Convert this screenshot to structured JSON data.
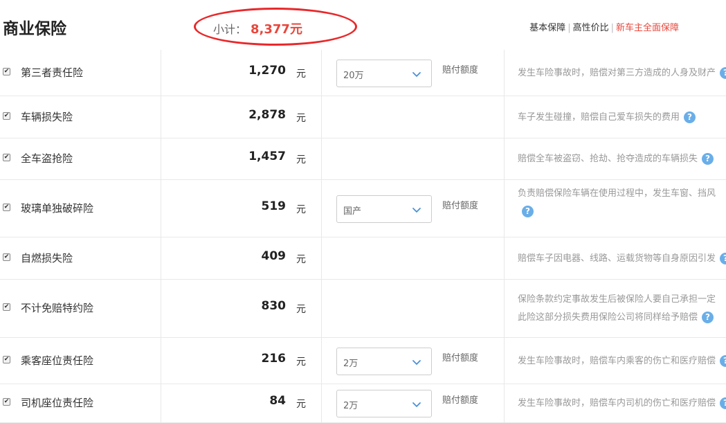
{
  "header": {
    "title": "商业保险",
    "subtotal_label": "小计：",
    "subtotal_value": "8,377元",
    "plans": [
      "基本保障",
      "高性价比",
      "新车主全面保障"
    ],
    "separator": "|"
  },
  "amount_label": "赔付额度",
  "help_glyph": "?",
  "rows": [
    {
      "name": "第三者责任险",
      "price": "1,270",
      "unit": "元",
      "select": "20万",
      "desc": [
        "发生车险事故时，赔偿对第三方造成的人身及财产"
      ]
    },
    {
      "name": "车辆损失险",
      "price": "2,878",
      "unit": "元",
      "select": null,
      "desc": [
        "车子发生碰撞，赔偿自己爱车损失的费用"
      ]
    },
    {
      "name": "全车盗抢险",
      "price": "1,457",
      "unit": "元",
      "select": null,
      "desc": [
        "赔偿全车被盗窃、抢劫、抢夺造成的车辆损失"
      ]
    },
    {
      "name": "玻璃单独破碎险",
      "price": "519",
      "unit": "元",
      "select": "国产",
      "desc": [
        "负责赔偿保险车辆在使用过程中，发生车窗、挡风"
      ]
    },
    {
      "name": "自燃损失险",
      "price": "409",
      "unit": "元",
      "select": null,
      "desc": [
        "赔偿车子因电器、线路、运载货物等自身原因引发"
      ]
    },
    {
      "name": "不计免赔特约险",
      "price": "830",
      "unit": "元",
      "select": null,
      "desc": [
        "保险条款约定事故发生后被保险人要自己承担一定",
        "此险这部分损失费用保险公司将同样给予赔偿"
      ]
    },
    {
      "name": "乘客座位责任险",
      "price": "216",
      "unit": "元",
      "select": "2万",
      "desc": [
        "发生车险事故时，赔偿车内乘客的伤亡和医疗赔偿"
      ]
    },
    {
      "name": "司机座位责任险",
      "price": "84",
      "unit": "元",
      "select": "2万",
      "desc": [
        "发生车险事故时，赔偿车内司机的伤亡和医疗赔偿"
      ]
    }
  ],
  "colors": {
    "accent": "#e8473c",
    "annotation": "#e8282b",
    "help": "#6aaee8"
  }
}
